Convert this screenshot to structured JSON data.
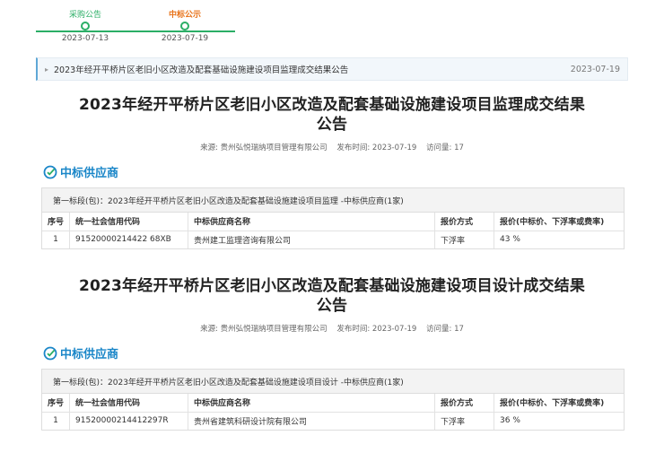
{
  "timeline": {
    "steps": [
      {
        "label": "采购公告",
        "date": "2023-07-13"
      },
      {
        "label": "中标公示",
        "date": "2023-07-19"
      }
    ]
  },
  "breadcrumb": {
    "text": "2023年经开平桥片区老旧小区改造及配套基础设施建设项目监理成交结果公告",
    "date": "2023-07-19"
  },
  "sections": [
    {
      "title_line1": "2023年经开平桥片区老旧小区改造及配套基础设施建设项目监理成交结果",
      "title_line2": "公告",
      "meta": {
        "source": "来源: 贵州弘悦瑞纳项目管理有限公司",
        "published": "发布时间: 2023-07-19",
        "views": "访问量: 17"
      },
      "winner_label": "中标供应商",
      "lot_header": "第一标段(包)：2023年经开平桥片区老旧小区改造及配套基础设施建设项目监理 -中标供应商(1家)",
      "columns": [
        "序号",
        "统一社会信用代码",
        "中标供应商名称",
        "报价方式",
        "报价(中标价、下浮率或费率)"
      ],
      "rows": [
        [
          "1",
          "91520000214422 68XB",
          "贵州建工监理咨询有限公司",
          "下浮率",
          "43 %"
        ]
      ]
    },
    {
      "title_line1": "2023年经开平桥片区老旧小区改造及配套基础设施建设项目设计成交结果",
      "title_line2": "公告",
      "meta": {
        "source": "来源: 贵州弘悦瑞纳项目管理有限公司",
        "published": "发布时间: 2023-07-19",
        "views": "访问量: 17"
      },
      "winner_label": "中标供应商",
      "lot_header": "第一标段(包)：2023年经开平桥片区老旧小区改造及配套基础设施建设项目设计 -中标供应商(1家)",
      "columns": [
        "序号",
        "统一社会信用代码",
        "中标供应商名称",
        "报价方式",
        "报价(中标价、下浮率或费率)"
      ],
      "rows": [
        [
          "1",
          "91520000214412297R",
          "贵州省建筑科研设计院有限公司",
          "下浮率",
          "36 %"
        ]
      ]
    }
  ],
  "colors": {
    "accent_green": "#2bae66",
    "accent_orange": "#e8731a",
    "accent_blue": "#1a86c8"
  }
}
